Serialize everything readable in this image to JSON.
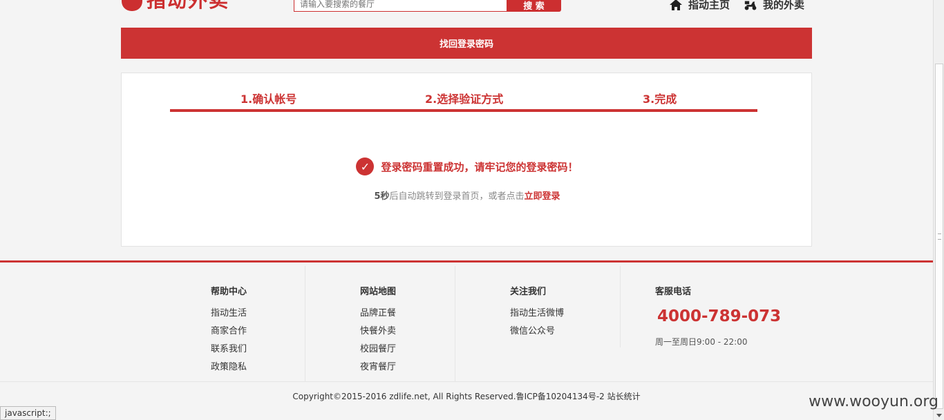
{
  "header": {
    "logo_text": "指动外卖",
    "search_placeholder": "请输入要搜索的餐厅",
    "search_button": "搜 索",
    "nav": [
      {
        "label": "指动主页",
        "icon": "home-icon"
      },
      {
        "label": "我的外卖",
        "icon": "scooter-icon"
      }
    ]
  },
  "title_bar": "找回登录密码",
  "steps": [
    "1.确认帐号",
    "2.选择验证方式",
    "3.完成"
  ],
  "result": {
    "message": "登录密码重置成功，请牢记您的登录密码！",
    "countdown": "5秒",
    "redirect_text": "后自动跳转到登录首页，或者点击",
    "login_link": "立即登录"
  },
  "footer": {
    "columns": [
      {
        "title": "帮助中心",
        "links": [
          "指动生活",
          "商家合作",
          "联系我们",
          "政策隐私"
        ]
      },
      {
        "title": "网站地图",
        "links": [
          "品牌正餐",
          "快餐外卖",
          "校园餐厅",
          "夜宵餐厅"
        ]
      },
      {
        "title": "关注我们",
        "links": [
          "指动生活微博",
          "微信公众号"
        ]
      }
    ],
    "service": {
      "title": "客服电话",
      "phone": "4000-789-073",
      "hours": "周一至周日9:00 - 22:00"
    },
    "copyright": "Copyright©2015-2016 zdlife.net, All Rights Reserved.鲁ICP备10204134号-2 站长统计"
  },
  "status_bar": "javascript:;",
  "watermark": "www.wooyun.org",
  "colors": {
    "accent": "#cc3333",
    "background": "#f4f4f4"
  }
}
